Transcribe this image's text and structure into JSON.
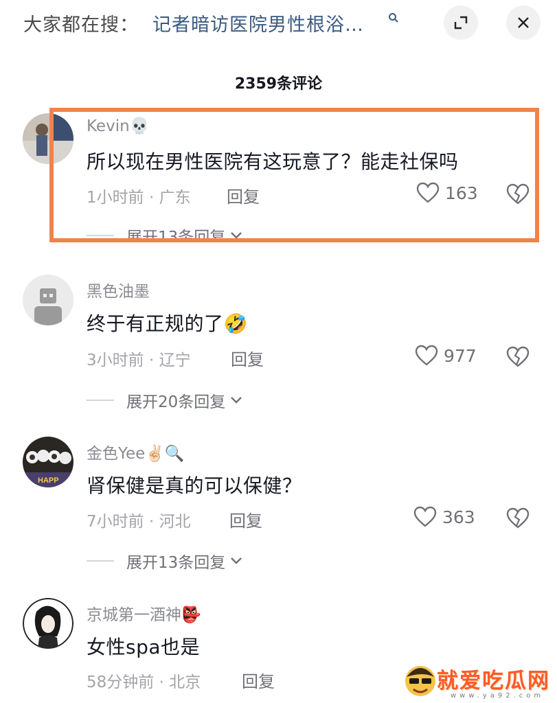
{
  "header": {
    "search_prefix": "大家都在搜：",
    "search_term": "记者暗访医院男性根浴…",
    "expand_icon": "expand-icon",
    "close_icon": "close-icon"
  },
  "comment_count": "2359条评论",
  "comments": [
    {
      "username": "Kevin💀",
      "content": "所以现在男性医院有这玩意了？能走社保吗",
      "time": "1小时前 · 广东",
      "reply": "回复",
      "likes": "163",
      "expand": "展开13条回复"
    },
    {
      "username": "黑色油墨",
      "content": "终于有正规的了🤣",
      "time": "3小时前 · 辽宁",
      "reply": "回复",
      "likes": "977",
      "expand": "展开20条回复"
    },
    {
      "username": "金色Yee✌🏻🔍",
      "content": "肾保健是真的可以保健？",
      "time": "7小时前 · 河北",
      "reply": "回复",
      "likes": "363",
      "expand": "展开13条回复"
    },
    {
      "username": "京城第一酒神👺",
      "content": "女性spa也是",
      "time": "58分钟前 · 北京",
      "reply": "回复"
    }
  ],
  "avatar_texts": {
    "c3": "HAPP"
  },
  "watermark": {
    "text": "就爱吃瓜网",
    "url": "www.ya92.com"
  },
  "colors": {
    "highlight": "#f0834a",
    "link": "#3a5a80",
    "watermark": "#ff5a2a"
  }
}
